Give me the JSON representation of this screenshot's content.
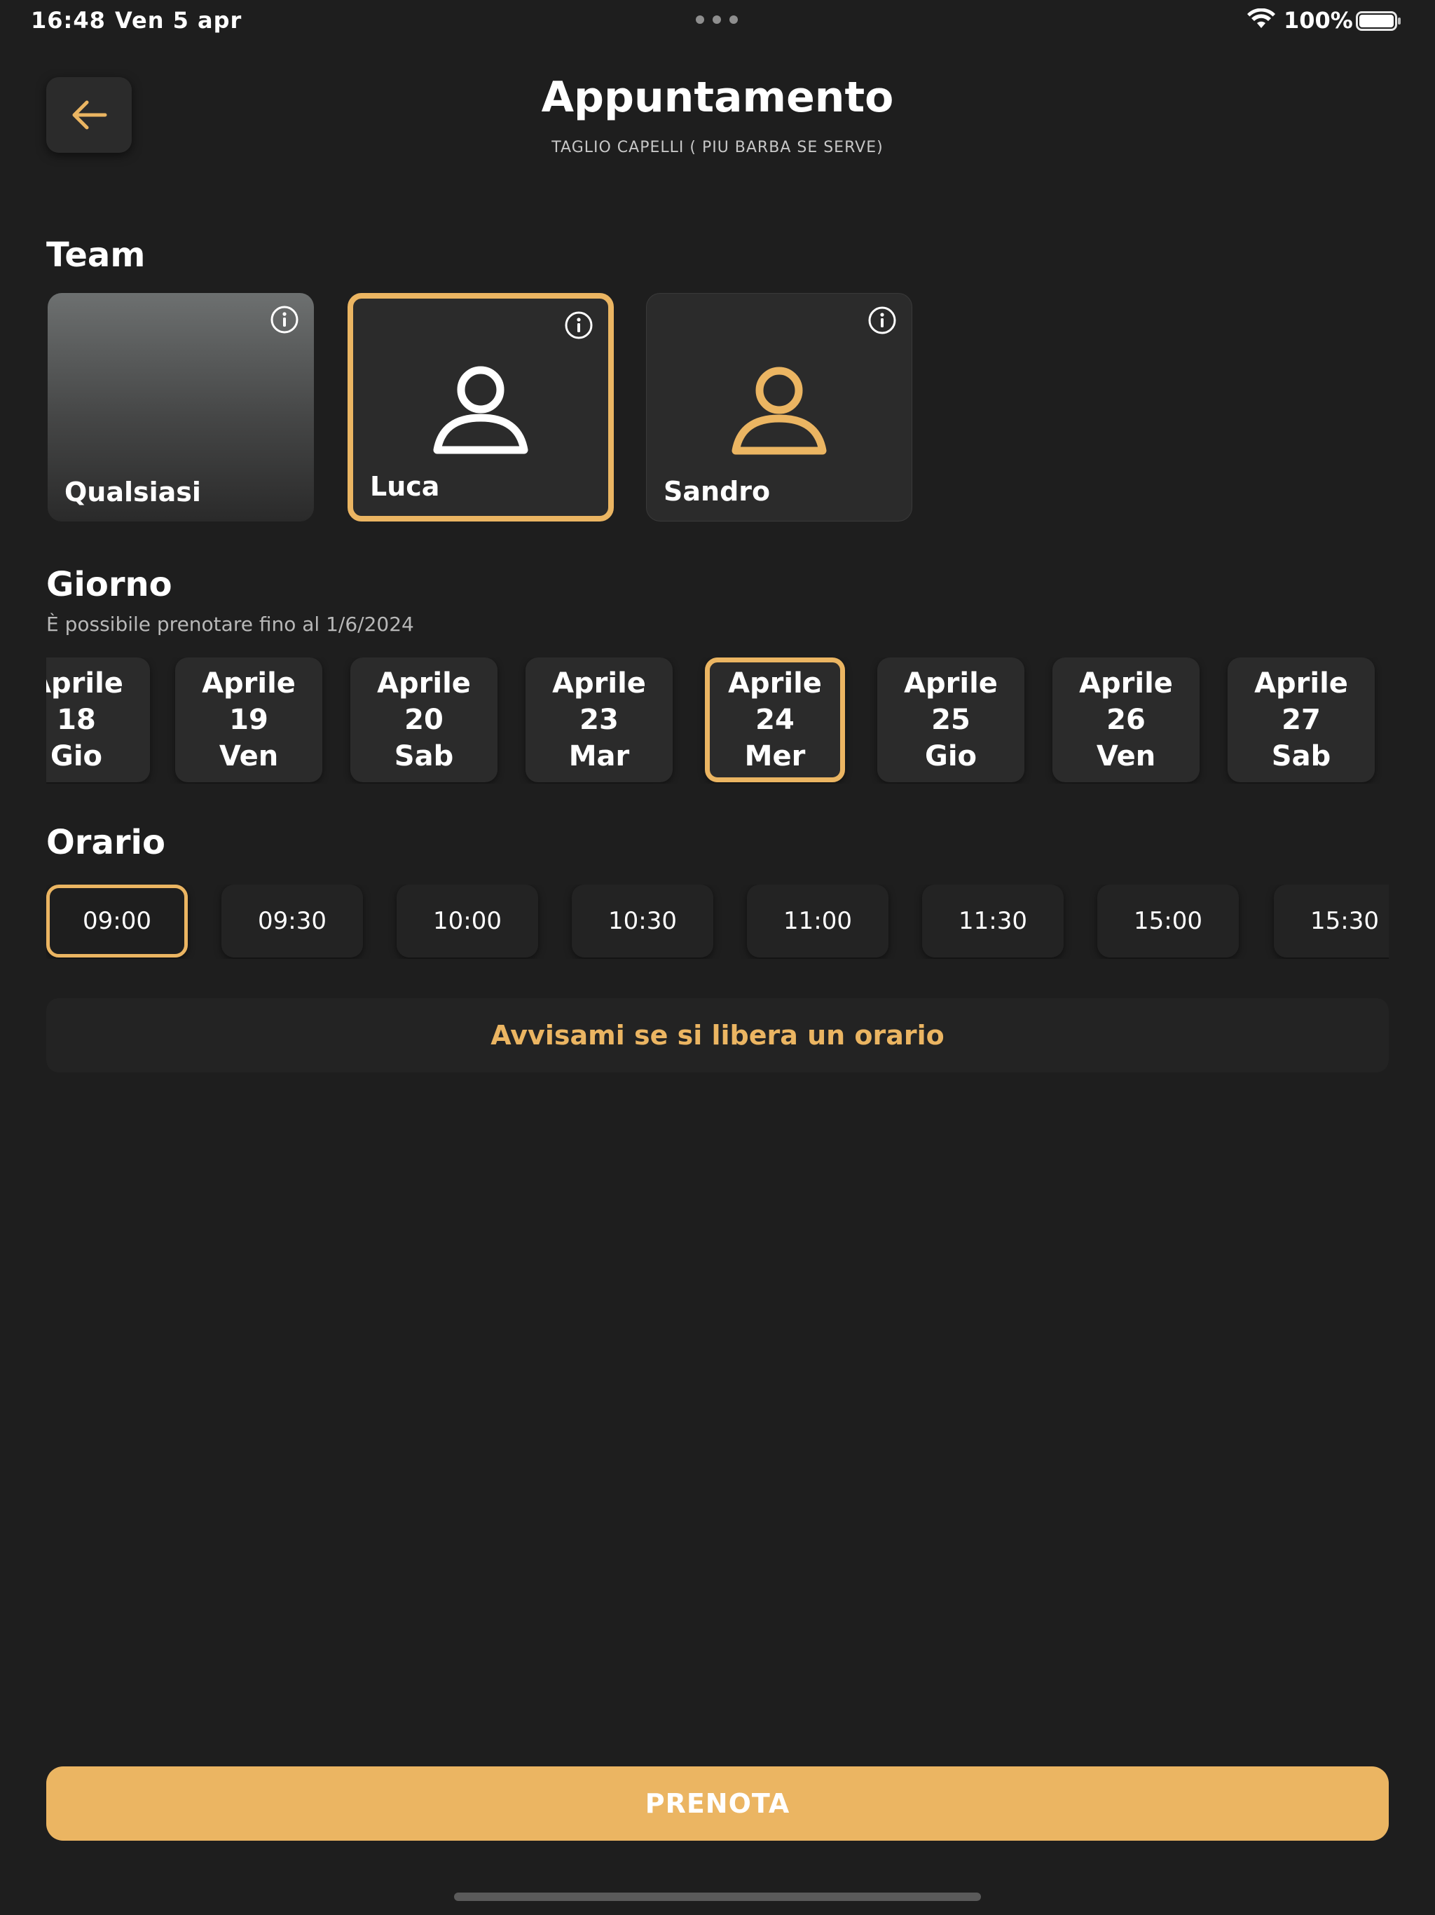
{
  "status_bar": {
    "time": "16:48",
    "date": "Ven 5 apr",
    "battery": "100%"
  },
  "header": {
    "title": "Appuntamento",
    "subtitle": "TAGLIO CAPELLI ( PIU BARBA SE SERVE)",
    "back_icon": "arrow-left-icon"
  },
  "team": {
    "title": "Team",
    "members": [
      {
        "name": "Qualsiasi"
      },
      {
        "name": "Luca",
        "selected": true
      },
      {
        "name": "Sandro"
      }
    ]
  },
  "day": {
    "title": "Giorno",
    "note": "È possibile prenotare fino al 1/6/2024",
    "days": [
      {
        "month": "Aprile",
        "number": "18",
        "weekday": "Gio"
      },
      {
        "month": "Aprile",
        "number": "19",
        "weekday": "Ven"
      },
      {
        "month": "Aprile",
        "number": "20",
        "weekday": "Sab"
      },
      {
        "month": "Aprile",
        "number": "23",
        "weekday": "Mar"
      },
      {
        "month": "Aprile",
        "number": "24",
        "weekday": "Mer",
        "selected": true
      },
      {
        "month": "Aprile",
        "number": "25",
        "weekday": "Gio"
      },
      {
        "month": "Aprile",
        "number": "26",
        "weekday": "Ven"
      },
      {
        "month": "Aprile",
        "number": "27",
        "weekday": "Sab"
      }
    ]
  },
  "time": {
    "title": "Orario",
    "slots": [
      "09:00",
      "09:30",
      "10:00",
      "10:30",
      "11:00",
      "11:30",
      "15:00",
      "15:30"
    ],
    "selected": "09:00"
  },
  "notify_label": "Avvisami se si libera un orario",
  "book_label": "PRENOTA",
  "colors": {
    "accent": "#ebb562",
    "background": "#1e1e1e",
    "card": "#2b2b2b"
  }
}
